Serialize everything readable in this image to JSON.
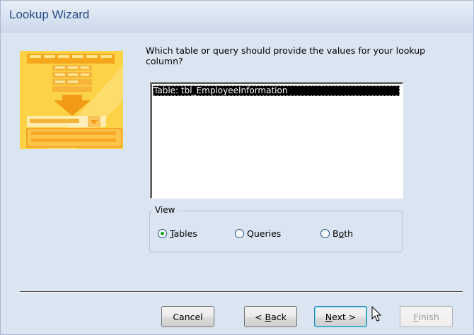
{
  "window": {
    "title": "Lookup Wizard"
  },
  "prompt": "Which table or query should provide the values for your lookup column?",
  "list": {
    "items": [
      "Table: tbl_EmployeeInformation"
    ],
    "selected_index": 0
  },
  "view_group": {
    "label": "View",
    "options": [
      {
        "label": "Tables",
        "mnemonic": "T",
        "rest": "ables",
        "selected": true
      },
      {
        "label": "Queries",
        "selected": false
      },
      {
        "label": "Both",
        "prefix": "B",
        "mnemonic": "o",
        "rest": "th",
        "selected": false
      }
    ]
  },
  "buttons": {
    "cancel": "Cancel",
    "back": {
      "prefix": "< ",
      "mnemonic": "B",
      "rest": "ack"
    },
    "next": {
      "mnemonic": "N",
      "rest": "ext >"
    },
    "finish": {
      "mnemonic": "F",
      "rest": "inish"
    }
  },
  "colors": {
    "accent": "#2a4c86",
    "selection": "#000000",
    "radio_dot": "#21a121"
  }
}
